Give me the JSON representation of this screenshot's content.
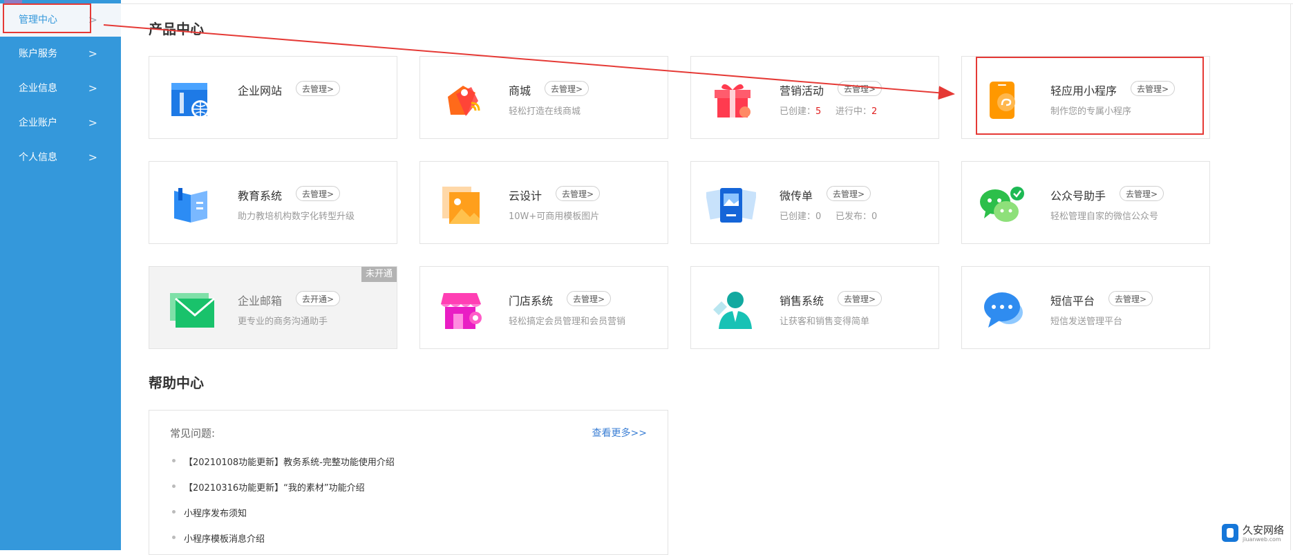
{
  "sidebar": {
    "items": [
      {
        "label": "管理中心",
        "active": true
      },
      {
        "label": "账户服务"
      },
      {
        "label": "企业信息"
      },
      {
        "label": "企业账户"
      },
      {
        "label": "个人信息"
      }
    ]
  },
  "products": {
    "title": "产品中心",
    "cards": [
      {
        "name": "企业网站",
        "action": "去管理>",
        "desc": "",
        "icon": "website-icon"
      },
      {
        "name": "商城",
        "action": "去管理>",
        "desc": "轻松打造在线商城",
        "icon": "shopping-tag-icon"
      },
      {
        "name": "营销活动",
        "action": "去管理>",
        "created_label": "已创建：",
        "created_value": "5",
        "running_label": "进行中：",
        "running_value": "2",
        "icon": "gift-icon"
      },
      {
        "name": "轻应用小程序",
        "action": "去管理>",
        "desc": "制作您的专属小程序",
        "icon": "mini-program-icon"
      },
      {
        "name": "教育系统",
        "action": "去管理>",
        "desc": "助力教培机构数字化转型升级",
        "icon": "book-icon"
      },
      {
        "name": "云设计",
        "action": "去管理>",
        "desc": "10W+可商用模板图片",
        "icon": "image-icon"
      },
      {
        "name": "微传单",
        "action": "去管理>",
        "created_label": "已创建：",
        "created_value": "0",
        "published_label": "已发布：",
        "published_value": "0",
        "icon": "flyer-icon"
      },
      {
        "name": "公众号助手",
        "action": "去管理>",
        "desc": "轻松管理自家的微信公众号",
        "icon": "wechat-icon"
      },
      {
        "name": "企业邮箱",
        "action": "去开通>",
        "desc": "更专业的商务沟通助手",
        "badge": "未开通",
        "icon": "mail-icon"
      },
      {
        "name": "门店系统",
        "action": "去管理>",
        "desc": "轻松搞定会员管理和会员营销",
        "icon": "store-icon"
      },
      {
        "name": "销售系统",
        "action": "去管理>",
        "desc": "让获客和销售变得简单",
        "icon": "sales-person-icon"
      },
      {
        "name": "短信平台",
        "action": "去管理>",
        "desc": "短信发送管理平台",
        "icon": "sms-icon"
      }
    ]
  },
  "help": {
    "title": "帮助中心",
    "faq_label": "常见问题:",
    "more": "查看更多>>",
    "items": [
      "【20210108功能更新】教务系统-完整功能使用介绍",
      "【20210316功能更新】“我的素材”功能介绍",
      "小程序发布须知",
      "小程序模板消息介绍"
    ]
  },
  "watermark": {
    "name": "久安网络",
    "site": "jiuanweb.com"
  },
  "colors": {
    "sidebar": "#3498db",
    "annotation": "#e53935",
    "link": "#3b7fd4",
    "count": "#e02020"
  }
}
